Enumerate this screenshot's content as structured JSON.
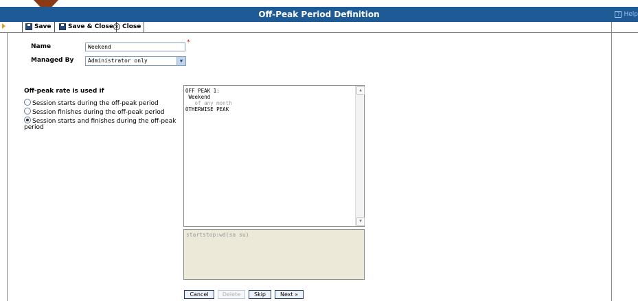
{
  "window": {
    "title": "Off-Peak Period Definition",
    "help_label": "Help"
  },
  "toolbar": {
    "save_label": "Save",
    "save_close_label": "Save & Close",
    "close_label": "Close"
  },
  "form": {
    "name_label": "Name",
    "name_value": "Weekend",
    "managed_by_label": "Managed By",
    "managed_by_value": "Administrator only",
    "rate_heading": "Off-peak rate is used if",
    "radio_options": [
      "Session starts during the off-peak period",
      "Session finishes during the off-peak period",
      "Session starts and finishes during the off-peak",
      "period"
    ],
    "selected_option": 2
  },
  "editor": {
    "lines": [
      "OFF PEAK 1:",
      " Weekend",
      "   of any month",
      "OTHERWISE PEAK"
    ],
    "rule_text": "startstop:wd(sa su)"
  },
  "buttons": {
    "cancel": "Cancel",
    "delete": "Delete",
    "skip": "Skip",
    "next": "Next »"
  },
  "colors": {
    "titlebar": "#1e5a96",
    "pointer": "#8a3a14"
  }
}
